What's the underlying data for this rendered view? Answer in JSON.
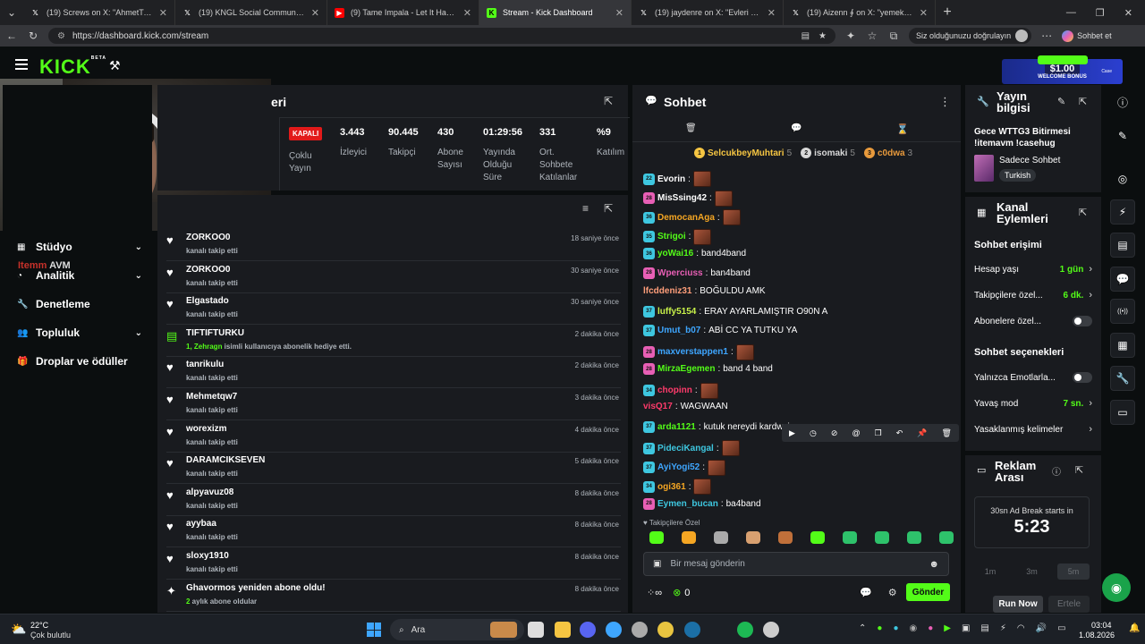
{
  "browser": {
    "tabs": [
      {
        "title": "(19) Screws on X: \"AhmetTurku B...",
        "icon": "x-icon"
      },
      {
        "title": "(19) KNGL Social Community / X",
        "icon": "x-icon"
      },
      {
        "title": "(9) Tame Impala - Let It Happen (O...",
        "icon": "youtube-icon"
      },
      {
        "title": "Stream - Kick Dashboard",
        "icon": "kick-icon",
        "active": true
      },
      {
        "title": "(19) jaydenre on X: \"Evleri yakın ol...",
        "icon": "x-icon"
      },
      {
        "title": "(19) Aizenn ∮ on X: \"yemek yay...",
        "icon": "x-icon"
      }
    ],
    "url": "https://dashboard.kick.com/stream",
    "incognito_label": "Siz olduğunuzu doğrulayın",
    "profile_label": "Sohbet et"
  },
  "header": {
    "logo": "KICK",
    "beta": "BETA",
    "promo": {
      "amount": "$1.00",
      "text": "WELCOME BONUS",
      "brand": "Case"
    }
  },
  "webcam": {
    "overlay_text": "AVM",
    "overlay_brand": "Itemm"
  },
  "sidebar": {
    "items": [
      {
        "label": "Stüdyo",
        "icon": "studio-icon",
        "expand": true
      },
      {
        "label": "Analitik",
        "icon": "analytics-icon",
        "expand": true
      },
      {
        "label": "Denetleme",
        "icon": "moderation-icon",
        "expand": false
      },
      {
        "label": "Topluluk",
        "icon": "community-icon",
        "expand": true
      },
      {
        "label": "Droplar ve ödüller",
        "icon": "drops-icon",
        "expand": false
      }
    ]
  },
  "stats": {
    "title_fragment": "eri",
    "status": "KAPALI",
    "status_label": "Çoklu Yayın",
    "items": [
      {
        "value": "3.443",
        "label": "İzleyici"
      },
      {
        "value": "90.445",
        "label": "Takipçi"
      },
      {
        "value": "430",
        "label": "Abone Sayısı"
      },
      {
        "value": "01:29:56",
        "label": "Yayında Olduğu Süre"
      },
      {
        "value": "331",
        "label": "Ort. Sohbete Katılanlar"
      },
      {
        "value": "%9",
        "label": "Katılım"
      }
    ]
  },
  "feed": {
    "rows": [
      {
        "name": "ZORKOO0",
        "sub": "kanalı takip etti",
        "time": "18 saniye önce",
        "type": "follow"
      },
      {
        "name": "ZORKOO0",
        "sub": "kanalı takip etti",
        "time": "30 saniye önce",
        "type": "follow"
      },
      {
        "name": "Elgastado",
        "sub": "kanalı takip etti",
        "time": "30 saniye önce",
        "type": "follow"
      },
      {
        "name": "TIFTIFTURKU",
        "sub_highlight": "1, Zehragn",
        "sub": " isimli kullanıcıya abonelik hediye etti.",
        "time": "2 dakika önce",
        "type": "gift"
      },
      {
        "name": "tanrikulu",
        "sub": "kanalı takip etti",
        "time": "2 dakika önce",
        "type": "follow"
      },
      {
        "name": "Mehmetqw7",
        "sub": "kanalı takip etti",
        "time": "3 dakika önce",
        "type": "follow"
      },
      {
        "name": "worexizm",
        "sub": "kanalı takip etti",
        "time": "4 dakika önce",
        "type": "follow"
      },
      {
        "name": "DARAMCIKSEVEN",
        "sub": "kanalı takip etti",
        "time": "5 dakika önce",
        "type": "follow"
      },
      {
        "name": "alpyavuz08",
        "sub": "kanalı takip etti",
        "time": "8 dakika önce",
        "type": "follow"
      },
      {
        "name": "ayybaa",
        "sub": "kanalı takip etti",
        "time": "8 dakika önce",
        "type": "follow"
      },
      {
        "name": "sloxy1910",
        "sub": "kanalı takip etti",
        "time": "8 dakika önce",
        "type": "follow"
      },
      {
        "name": "Ghavormos yeniden abone oldu!",
        "sub_highlight": "2",
        "sub": " aylık abone oldular",
        "time": "8 dakika önce",
        "type": "resub"
      }
    ]
  },
  "chat": {
    "title": "Sohbet",
    "top_gifters": [
      {
        "rank": "1",
        "name": "SelcukbeyMuhtari",
        "count": "5",
        "color": "#f5c542"
      },
      {
        "rank": "2",
        "name": "isomaki",
        "count": "5",
        "color": "#d8d8d8"
      },
      {
        "rank": "3",
        "name": "c0dwa",
        "count": "3",
        "color": "#e89a3c"
      }
    ],
    "messages": [
      {
        "badge": "22",
        "badge_color": "#3ec7e0",
        "user": "Evorin",
        "color": "#ffffff",
        "text": "",
        "emote": true
      },
      {
        "badge": "28",
        "badge_color": "#e85fb5",
        "user": "MisSsing42",
        "color": "#ffffff",
        "text": "",
        "emote": true
      },
      {
        "badge": "36",
        "badge_color": "#3ec7e0",
        "user": "DemocanAga",
        "color": "#f5a623",
        "text": "",
        "emote": true
      },
      {
        "badge": "35",
        "badge_color": "#3ec7e0",
        "user": "Strigoi",
        "color": "#53fc18",
        "text": "",
        "emote": true
      },
      {
        "badge": "36",
        "badge_color": "#3ec7e0",
        "user": "yoWai16",
        "color": "#53fc18",
        "text": "band4band",
        "emote": false
      },
      {
        "badge": "28",
        "badge_color": "#e85fb5",
        "user": "Wperciuss",
        "color": "#e85fb5",
        "text": "ban4band",
        "emote": false
      },
      {
        "badge": "",
        "badge_color": "",
        "user": "lfcddeniz31",
        "color": "#ff9e7a",
        "text": "BOĞULDU AMK",
        "emote": false
      },
      {
        "badge": "37",
        "badge_color": "#3ec7e0",
        "user": "luffy5154",
        "color": "#c9f24a",
        "text": "ERAY AYARLAMIŞTIR O90N A",
        "emote": false
      },
      {
        "badge": "37",
        "badge_color": "#3ec7e0",
        "user": "Umut_b07",
        "color": "#3ea6ff",
        "text": "ABİ CC YA TUTKU YA",
        "emote": false
      },
      {
        "badge": "28",
        "badge_color": "#e85fb5",
        "user": "maxverstappen1",
        "color": "#3ea6ff",
        "text": "",
        "emote": true
      },
      {
        "badge": "28",
        "badge_color": "#e85fb5",
        "user": "MirzaEgemen",
        "color": "#53fc18",
        "text": "band 4 band",
        "emote": false
      },
      {
        "badge": "34",
        "badge_color": "#3ec7e0",
        "user": "chopinn",
        "color": "#ff3b6b",
        "text": "",
        "emote": true
      },
      {
        "badge": "",
        "badge_color": "",
        "user": "visQ17",
        "color": "#ff3b6b",
        "text": "WAGWAAN",
        "emote": false
      },
      {
        "badge": "37",
        "badge_color": "#3ec7e0",
        "user": "arda1121",
        "color": "#53fc18",
        "text": "kutuk nereydi kardwsim",
        "emote": false
      },
      {
        "badge": "37",
        "badge_color": "#3ec7e0",
        "user": "PideciKangal",
        "color": "#3ec7e0",
        "text": "",
        "emote": true
      },
      {
        "badge": "37",
        "badge_color": "#3ec7e0",
        "user": "AyiYogi52",
        "color": "#3ea6ff",
        "text": "",
        "emote": true
      },
      {
        "badge": "34",
        "badge_color": "#3ec7e0",
        "user": "ogi361",
        "color": "#f5a623",
        "text": "",
        "emote": true
      },
      {
        "badge": "28",
        "badge_color": "#e85fb5",
        "user": "Eymen_bucan",
        "color": "#3ec7e0",
        "text": "ba4band",
        "emote": false
      }
    ],
    "followers_only": "Takipçilere Özel",
    "input_placeholder": "Bir mesaj gönderin",
    "viewers": "0",
    "send_label": "Gönder"
  },
  "stream_info": {
    "title": "Yayın bilgisi",
    "stream_title": "Gece WTTG3 Bitirmesi !itemavm !casehug",
    "category": "Sadece Sohbet",
    "tag": "Turkish"
  },
  "channel_actions": {
    "title": "Kanal Eylemleri",
    "chat_access": "Sohbet erişimi",
    "rows": [
      {
        "label": "Hesap yaşı",
        "value": "1 gün",
        "kind": "chev"
      },
      {
        "label": "Takipçilere özel...",
        "value": "6 dk.",
        "kind": "chev"
      },
      {
        "label": "Abonelere özel...",
        "value": "",
        "kind": "toggle"
      }
    ],
    "chat_options": "Sohbet seçenekleri",
    "rows2": [
      {
        "label": "Yalnızca Emotlarla...",
        "value": "",
        "kind": "toggle"
      },
      {
        "label": "Yavaş mod",
        "value": "7 sn.",
        "kind": "chev"
      },
      {
        "label": "Yasaklanmış kelimeler",
        "value": "",
        "kind": "chev"
      }
    ]
  },
  "ad_break": {
    "title": "Reklam Arası",
    "starts_in": "30sn Ad Break starts in",
    "countdown": "5:23",
    "options": [
      "1m",
      "3m",
      "5m"
    ],
    "run_now": "Run Now",
    "postpone": "Ertele"
  },
  "taskbar": {
    "weather_temp": "22°C",
    "weather_desc": "Çok bulutlu",
    "search": "Ara",
    "time": "03:04",
    "date": "1.08.2026"
  }
}
